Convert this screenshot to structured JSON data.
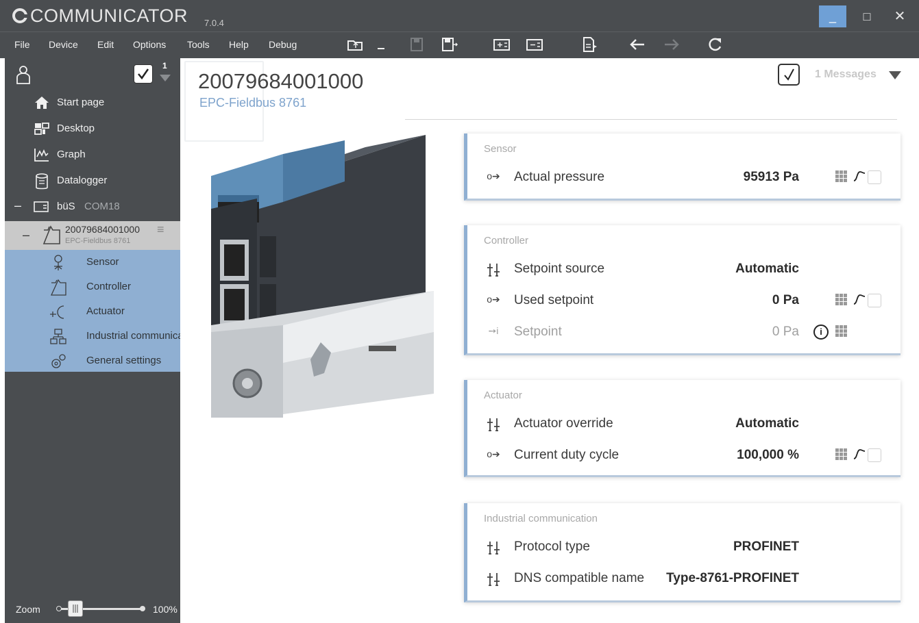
{
  "app": {
    "name": "COMMUNICATOR",
    "version": "7.0.4",
    "window_buttons": {
      "minimize": "_",
      "maximize": "□",
      "close": "✕"
    }
  },
  "menu": {
    "items": [
      "File",
      "Device",
      "Edit",
      "Options",
      "Tools",
      "Help",
      "Debug"
    ]
  },
  "toolbar": {
    "icons": [
      "open-folder-icon",
      "save-icon",
      "save-as-icon",
      "add-device-icon",
      "remove-device-icon",
      "export-pdf-icon",
      "back-arrow-icon",
      "forward-arrow-icon",
      "refresh-icon"
    ]
  },
  "sidebar": {
    "message_count": "1",
    "nav": [
      {
        "label": "Start page",
        "icon": "home-icon"
      },
      {
        "label": "Desktop",
        "icon": "desktop-icon"
      },
      {
        "label": "Graph",
        "icon": "graph-icon"
      },
      {
        "label": "Datalogger",
        "icon": "datalogger-icon"
      }
    ],
    "bus": {
      "toggle": "–",
      "label": "büS",
      "port": "COM18"
    },
    "device": {
      "toggle": "–",
      "serial": "20079684001000",
      "model": "EPC-Fieldbus 8761",
      "menu": "≡"
    },
    "subitems": [
      {
        "label": "Sensor",
        "icon": "sensor-icon"
      },
      {
        "label": "Controller",
        "icon": "controller-icon"
      },
      {
        "label": "Actuator",
        "icon": "actuator-icon"
      },
      {
        "label": "Industrial communication",
        "icon": "industrial-communication-icon"
      },
      {
        "label": "General settings",
        "icon": "general-settings-icon"
      }
    ],
    "zoom": {
      "label": "Zoom",
      "value": "100%",
      "level": 0.5
    }
  },
  "main": {
    "device_serial": "20079684001000",
    "device_model": "EPC-Fieldbus 8761",
    "messages_label": "1 Messages",
    "colors": {
      "accent": "#8fafd2",
      "sidebar": "#4a4d50",
      "titlebar": "#4a4d50"
    },
    "cards": [
      {
        "title": "Sensor",
        "rows": [
          {
            "icon": "output-icon",
            "label": "Actual pressure",
            "value": "95913 Pa",
            "tools": true
          }
        ]
      },
      {
        "title": "Controller",
        "rows": [
          {
            "icon": "parameter-icon",
            "label": "Setpoint source",
            "value": "Automatic",
            "tools": false
          },
          {
            "icon": "output-icon",
            "label": "Used setpoint",
            "value": "0 Pa",
            "tools": true
          },
          {
            "icon": "input-icon",
            "label": "Setpoint",
            "value": "0 Pa",
            "tools": false,
            "info": true,
            "dim": true
          }
        ]
      },
      {
        "title": "Actuator",
        "rows": [
          {
            "icon": "parameter-icon",
            "label": "Actuator override",
            "value": "Automatic",
            "tools": false
          },
          {
            "icon": "output-icon",
            "label": "Current duty cycle",
            "value": "100,000 %",
            "tools": true
          }
        ]
      },
      {
        "title": "Industrial communication",
        "rows": [
          {
            "icon": "parameter-icon",
            "label": "Protocol type",
            "value": "PROFINET",
            "tools": false
          },
          {
            "icon": "parameter-icon",
            "label": "DNS compatible name",
            "value": "Type-8761-PROFINET",
            "tools": false
          }
        ]
      }
    ]
  }
}
